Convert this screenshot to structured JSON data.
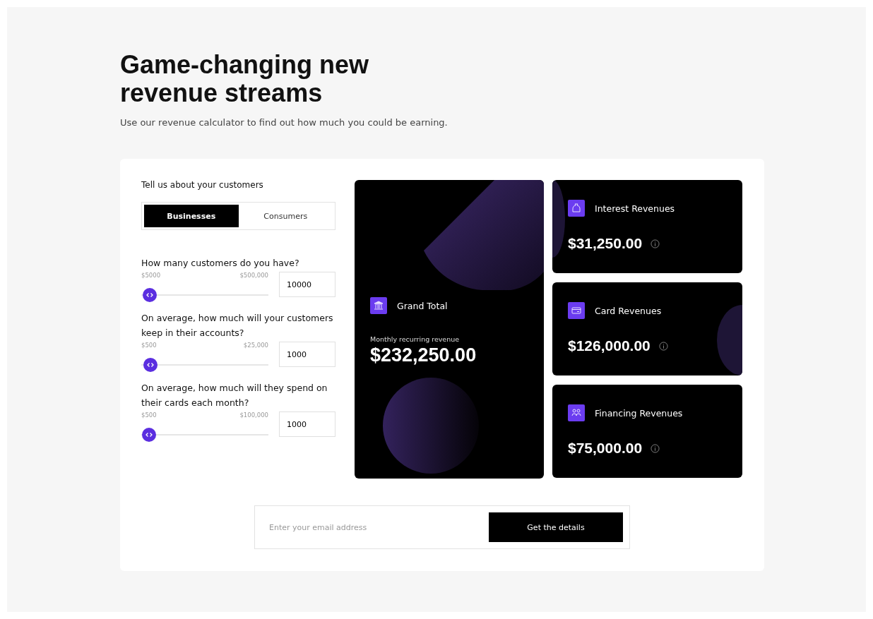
{
  "heading": "Game-changing new revenue streams",
  "subheading": "Use our revenue calculator to find out how much you could be earning.",
  "calculator": {
    "prompt": "Tell us about your customers",
    "segments": [
      {
        "label": "Businesses",
        "selected": true
      },
      {
        "label": "Consumers",
        "selected": false
      }
    ],
    "questions": [
      {
        "label": "How many customers do you have?",
        "min": "$5000",
        "max": "$500,000",
        "level": 0.01,
        "value": "10000"
      },
      {
        "label": "On average, how much will your customers keep in their accounts?",
        "min": "$500",
        "max": "$25,000",
        "level": 0.02,
        "value": "1000"
      },
      {
        "label": "On average, how much will they spend on their cards each month?",
        "min": "$500",
        "max": "$100,000",
        "level": 0.005,
        "value": "1000"
      }
    ]
  },
  "grand_total": {
    "title": "Grand Total",
    "caption": "Monthly recurring revenue",
    "amount": "$232,250.00"
  },
  "revenues": [
    {
      "kind": "interest",
      "title": "Interest Revenues",
      "amount": "$31,250.00"
    },
    {
      "kind": "card",
      "title": "Card Revenues",
      "amount": "$126,000.00"
    },
    {
      "kind": "financing",
      "title": "Financing Revenues",
      "amount": "$75,000.00"
    }
  ],
  "signup": {
    "placeholder": "Enter your email address",
    "button": "Get the details"
  }
}
